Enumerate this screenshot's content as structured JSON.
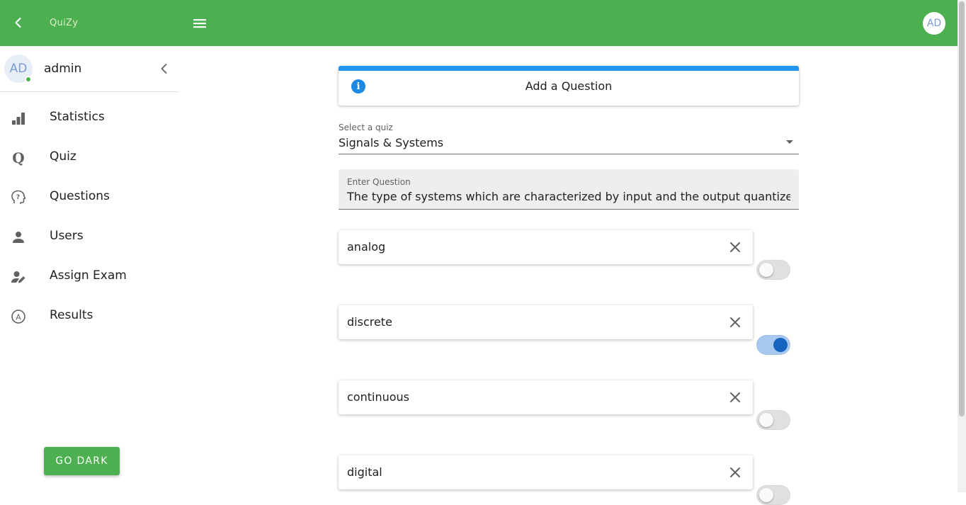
{
  "appbar": {
    "brand": "QuiZy",
    "avatar": "AD",
    "color": "#4caf50"
  },
  "sidebar": {
    "avatar": "AD",
    "username": "admin",
    "items": [
      {
        "label": "Statistics",
        "icon": "bar-chart-icon"
      },
      {
        "label": "Quiz",
        "icon": "quiz-q-icon"
      },
      {
        "label": "Questions",
        "icon": "question-head-icon"
      },
      {
        "label": "Users",
        "icon": "person-icon"
      },
      {
        "label": "Assign Exam",
        "icon": "person-edit-icon"
      },
      {
        "label": "Results",
        "icon": "results-circle-icon"
      }
    ],
    "go_dark": "GO DARK"
  },
  "main": {
    "card_title": "Add a Question",
    "select_label": "Select a quiz",
    "select_value": "Signals & Systems",
    "question_label": "Enter Question",
    "question_value": "The type of systems which are characterized by input and the output quantized at certain levels are called as",
    "options": [
      {
        "text": "analog",
        "correct": false
      },
      {
        "text": "discrete",
        "correct": true
      },
      {
        "text": "continuous",
        "correct": false
      },
      {
        "text": "digital",
        "correct": false
      }
    ],
    "accent": "#2196f3"
  }
}
